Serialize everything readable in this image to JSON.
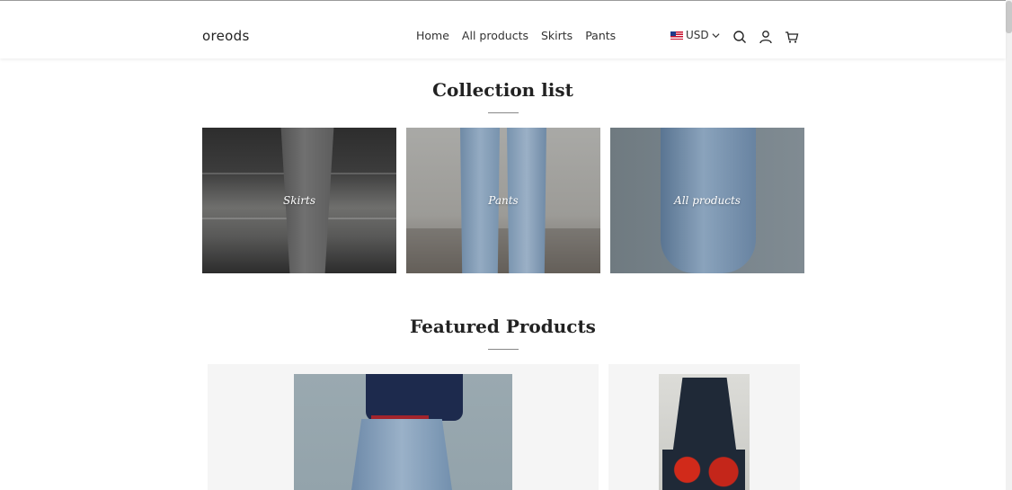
{
  "header": {
    "logo": "oreods",
    "nav": [
      {
        "label": "Home"
      },
      {
        "label": "All products"
      },
      {
        "label": "Skirts"
      },
      {
        "label": "Pants"
      }
    ],
    "currency": "USD",
    "icons": [
      "search-icon",
      "account-icon",
      "cart-icon"
    ]
  },
  "collection": {
    "title": "Collection list",
    "items": [
      {
        "label": "Skirts"
      },
      {
        "label": "Pants"
      },
      {
        "label": "All products"
      }
    ]
  },
  "featured": {
    "title": "Featured Products"
  },
  "colors": {
    "text": "#222222",
    "accent_rule": "#888888",
    "card_bg": "#f5f5f5"
  }
}
